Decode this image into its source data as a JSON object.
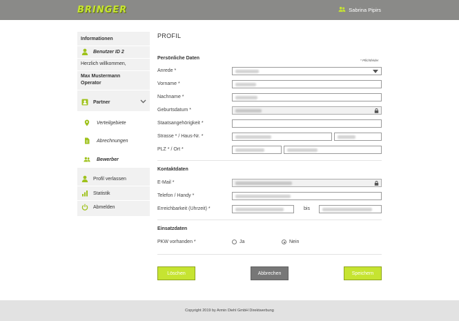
{
  "header": {
    "logo": "BRINGER",
    "user_name": "Sabrina Pipirs"
  },
  "sidebar": {
    "heading": "Informationen",
    "user_id": "Benutzer ID 2",
    "welcome": "Herzlich willkommen,",
    "name": "Max Mustermann",
    "role": "Operator",
    "partner": "Partner",
    "sub_items": [
      "Verteilgebiete",
      "Abrechnungen",
      "Bewerber"
    ],
    "items": [
      "Profil verlassen",
      "Statistik",
      "Abmelden"
    ]
  },
  "page": {
    "title": "PROFIL",
    "required_note": "* Pflichtfelder"
  },
  "personal": {
    "title": "Persönliche Daten",
    "labels": {
      "anrede": "Anrede *",
      "vorname": "Vorname *",
      "nachname": "Nachname *",
      "geburtsdatum": "Geburtsdatum *",
      "staat": "Staatsangehörigkeit *",
      "strasse": "Strasse * / Haus-Nr. *",
      "plz": "PLZ * / Ort *"
    }
  },
  "contact": {
    "title": "Kontaktdaten",
    "labels": {
      "email": "E-Mail *",
      "telefon": "Telefon / Handy *",
      "erreichbarkeit": "Erreichbarkeit (Uhrzeit) *",
      "bis": "bis"
    }
  },
  "einsatz": {
    "title": "Einsatzdaten",
    "pkw_label": "PKW vorhanden *",
    "options": [
      "Ja",
      "Nein"
    ],
    "selected": "Nein"
  },
  "buttons": {
    "delete": "Löschen",
    "cancel": "Abbrechen",
    "save": "Speichern"
  },
  "footer": {
    "copyright": "Copyright 2019 by Armin Diehl GmbH Direktwerbung"
  },
  "colors": {
    "accent": "#c6e431",
    "header_bg": "#8a8a88",
    "sidebar_bg": "#f1f1f1",
    "icon_green": "#9fc21d"
  }
}
